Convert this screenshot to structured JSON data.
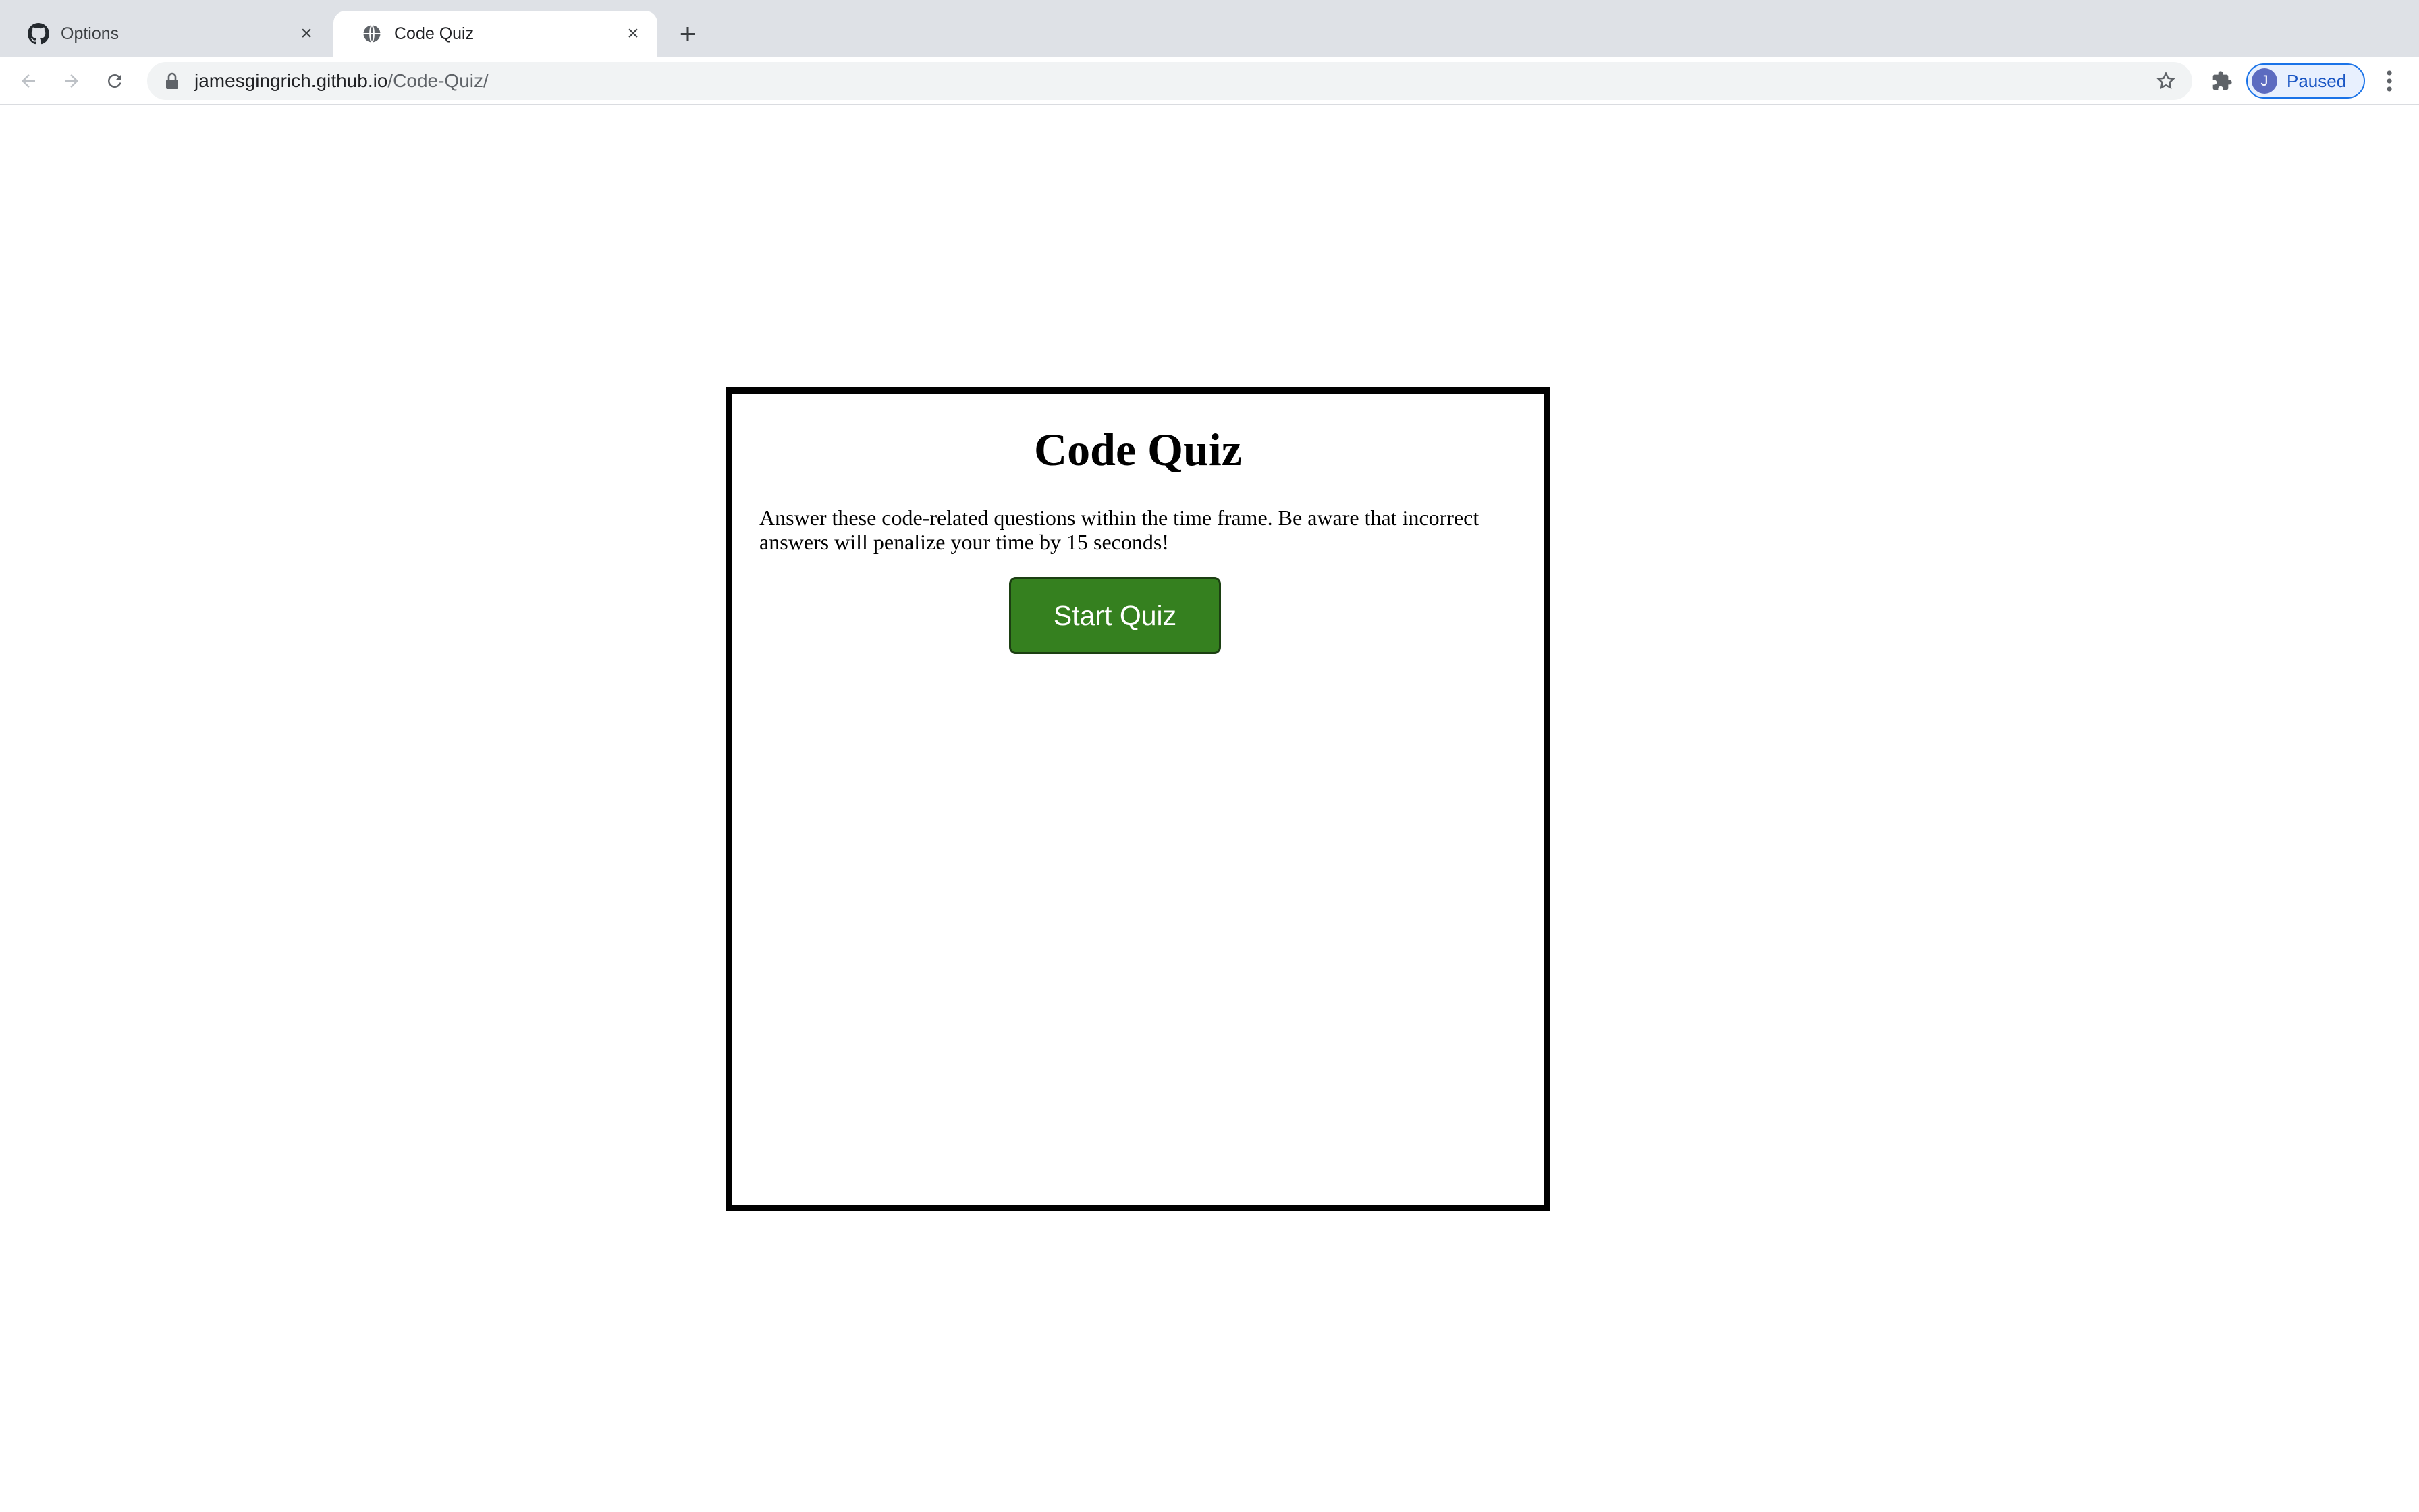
{
  "browser": {
    "tabs": [
      {
        "title": "Options",
        "icon": "github-icon",
        "active": false
      },
      {
        "title": "Code Quiz",
        "icon": "globe-icon",
        "active": true
      }
    ],
    "new_tab_label": "+",
    "close_glyph": "×",
    "url_host": "jamesgingrich.github.io",
    "url_path": "/Code-Quiz/",
    "profile": {
      "initial": "J",
      "label": "Paused"
    }
  },
  "page": {
    "title": "Code Quiz",
    "description": "Answer these code-related questions within the time frame. Be aware that incorrect answers will penalize your time by 15 seconds!",
    "start_button": "Start Quiz"
  },
  "colors": {
    "start_button_bg": "#35801f",
    "tabstrip_bg": "#dee1e6",
    "profile_accent": "#1a73e8"
  }
}
